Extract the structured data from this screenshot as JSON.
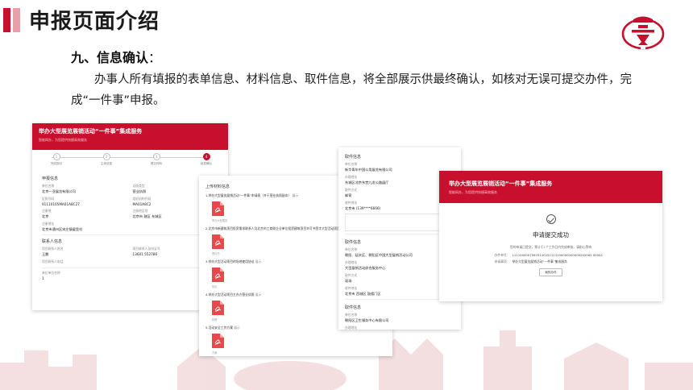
{
  "slide": {
    "title": "申报页面介绍",
    "section_title": "九、信息确认",
    "section_colon": "：",
    "description": "办事人所有填报的表单信息、材料信息、取件信息，将全部展示供最终确认，如核对无误可提交办件，完成“一件事”申报。",
    "colors": {
      "brand_red": "#c8102e",
      "accent_pink": "#e8a0a8"
    }
  },
  "form_panel": {
    "banner_title": "举办大型展览展销活动“一件事”集成服务",
    "banner_subtitle": "智能网办，为您提供快捷高效服务",
    "steps": [
      {
        "num": "1",
        "label": "完成指引"
      },
      {
        "num": "2",
        "label": "主体信息"
      },
      {
        "num": "3",
        "label": "提交材料"
      },
      {
        "num": "4",
        "label": "信息确认"
      }
    ],
    "section_heading": "申报信息",
    "fields": [
      {
        "k": "单位名称",
        "v": "北京一亚展览有限公司"
      },
      {
        "k": "证照类型",
        "v": "营业执照"
      },
      {
        "k": "证照号码",
        "v": "91110105MA01A8C27"
      },
      {
        "k": "组织机构代码",
        "v": "MA01A8C2"
      },
      {
        "k": "注册地",
        "v": "北京"
      },
      {
        "k": "注册地区划",
        "v": "北京市 辖区 东城区"
      },
      {
        "k": "注册地址",
        "v": "北京市通州区宋庄镇翟里村"
      }
    ],
    "contact_heading": "联系人信息",
    "contact_fields": [
      {
        "k": "项目联系人姓名",
        "v": "王鹏"
      },
      {
        "k": "项目联系人身份证号",
        "v": "13601 552786"
      },
      {
        "k": "项目联系人电话",
        "v": ""
      }
    ],
    "extra_label": "单位单位名称",
    "extra_value": "1"
  },
  "materials_panel": {
    "heading": "上传材料信息",
    "items": [
      {
        "title": "1.举办大型展览展销活动“一件事”申请表（并于营业执照副本）",
        "tag": "展示",
        "file": "举办大型展览"
      },
      {
        "title": "2.北京市新建筑项目投资需求联系人及北京市工商联企业单位投资建筑项目许可书签字大型活动项目",
        "tag": "展示",
        "file": "签约书"
      },
      {
        "title": "3.举办大型活动项目的场地使用协议",
        "tag": "展示",
        "file": "协议"
      },
      {
        "title": "4.举办大型活动项目主办方营业执照",
        "tag": "展示",
        "file": "执照"
      },
      {
        "title": "5.活动安全工作方案",
        "tag": "展示",
        "file": "方案"
      }
    ]
  },
  "pickup_panel": {
    "blocks": [
      {
        "heading": "取件信息",
        "rows": [
          {
            "k": "单位名称",
            "v": "新华青年中国公用展览有限公司"
          },
          {
            "k": "办理地址",
            "v": "东城区北京东宫九龙公路展厅"
          },
          {
            "k": "取件方式",
            "v": "邮寄"
          },
          {
            "k": "收件地址",
            "v": "北京市 (139****6666)"
          }
        ]
      },
      {
        "heading": "取件信息",
        "rows": [
          {
            "k": "单位名称",
            "v": "朝阳、延庆区、朝阳区中国大型展销活动公司"
          },
          {
            "k": "办理地址",
            "v": "大型展销活动综合服务中心"
          },
          {
            "k": "取件方式",
            "v": "现场"
          },
          {
            "k": "收件地址",
            "v": "北京市 西城区 鼓楼门区"
          }
        ]
      },
      {
        "heading": "取件信息",
        "rows": [
          {
            "k": "单位名称",
            "v": "朝阳区卫生服务中心有限公司"
          },
          {
            "k": "办理地址",
            "v": "朝阳区卫生服务中心"
          }
        ]
      }
    ]
  },
  "success_panel": {
    "banner_title": "举办大型展览展销活动“一件事”集成服务",
    "banner_subtitle": "智能网办，为您提供快捷高效服务",
    "title": "申请提交成功",
    "note": "您的申请已提交，预计于1个工作日内完成审核，请耐心等待",
    "rows": [
      {
        "k": "办件单号：",
        "v": "11110000075670120252113100000000000202062 00002"
      },
      {
        "k": "申请事项：",
        "v": "举办大型展览展销活动“一件事”集成服务"
      }
    ],
    "button_label": "我的办件"
  }
}
